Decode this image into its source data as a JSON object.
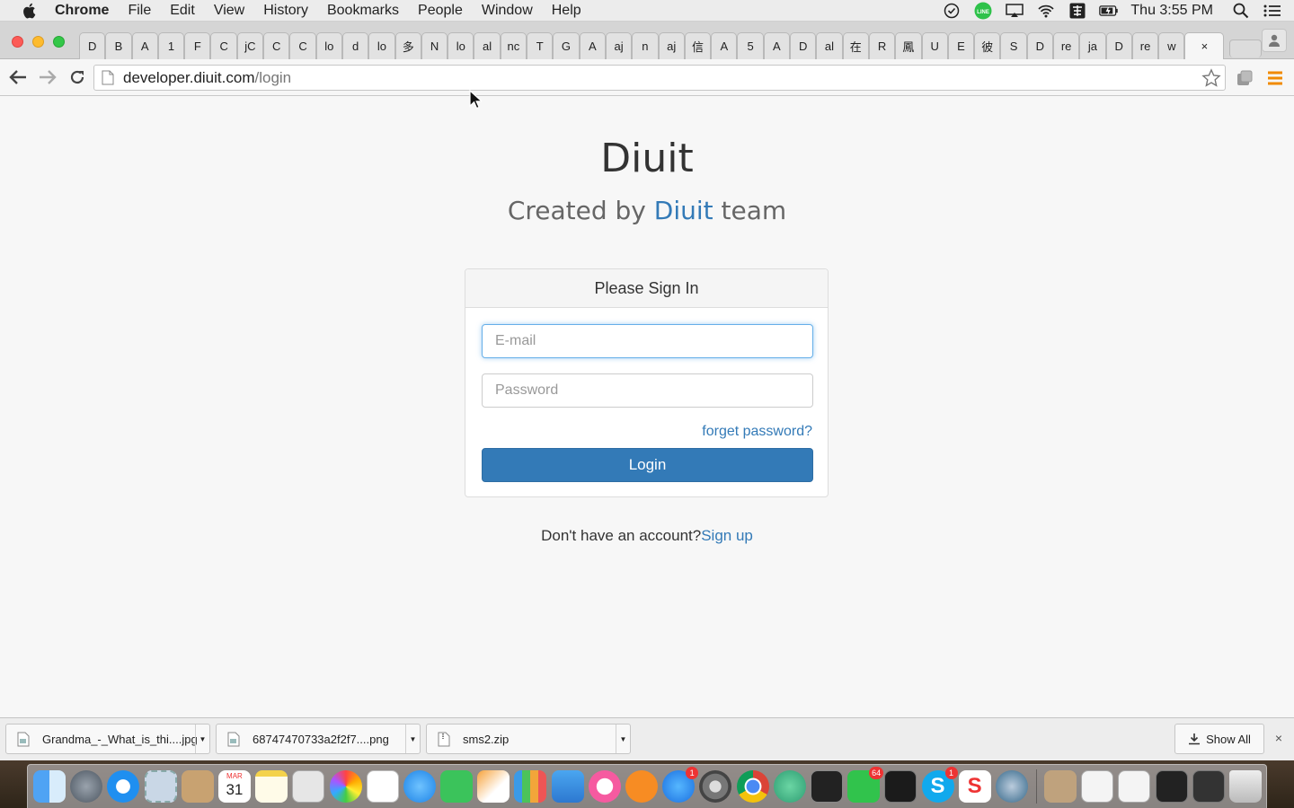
{
  "menubar": {
    "items": [
      "Chrome",
      "File",
      "Edit",
      "View",
      "History",
      "Bookmarks",
      "People",
      "Window",
      "Help"
    ],
    "clock": "Thu 3:55 PM"
  },
  "tabs": {
    "labels": [
      "D",
      "B",
      "A",
      "1",
      "F",
      "C",
      "jC",
      "C",
      "C",
      "lo",
      "d",
      "lo",
      "多",
      "N",
      "lo",
      "al",
      "nc",
      "T",
      "G",
      "A",
      "aj",
      "n",
      "aj",
      "信",
      "A",
      "5",
      "A",
      "D",
      "al",
      "在",
      "R",
      "鳳",
      "U",
      "E",
      "彼",
      "S",
      "D",
      "re",
      "ja",
      "D",
      "re",
      "w"
    ],
    "active_close": "×"
  },
  "toolbar": {
    "url_host": "developer.diuit.com",
    "url_path": "/login"
  },
  "page": {
    "title": "Diuit",
    "subtitle_prefix": "Created by ",
    "subtitle_brand": "Diuit",
    "subtitle_suffix": " team",
    "panel_heading": "Please Sign In",
    "email_placeholder": "E-mail",
    "password_placeholder": "Password",
    "forgot_label": "forget password?",
    "login_label": "Login",
    "signup_prompt": "Don't have an account?",
    "signup_link": "Sign up"
  },
  "downloads": {
    "items": [
      {
        "name": "Grandma_-_What_is_thi....jpg"
      },
      {
        "name": "68747470733a2f2f7....png"
      },
      {
        "name": "sms2.zip"
      }
    ],
    "show_all": "Show All",
    "close": "×"
  },
  "dock": {
    "calendar_month": "MAR",
    "calendar_day": "31",
    "line_badge": "64",
    "appstore_badge": "1",
    "skype_badge": "1"
  },
  "colors": {
    "link": "#337ab7",
    "button": "#337ab7"
  }
}
